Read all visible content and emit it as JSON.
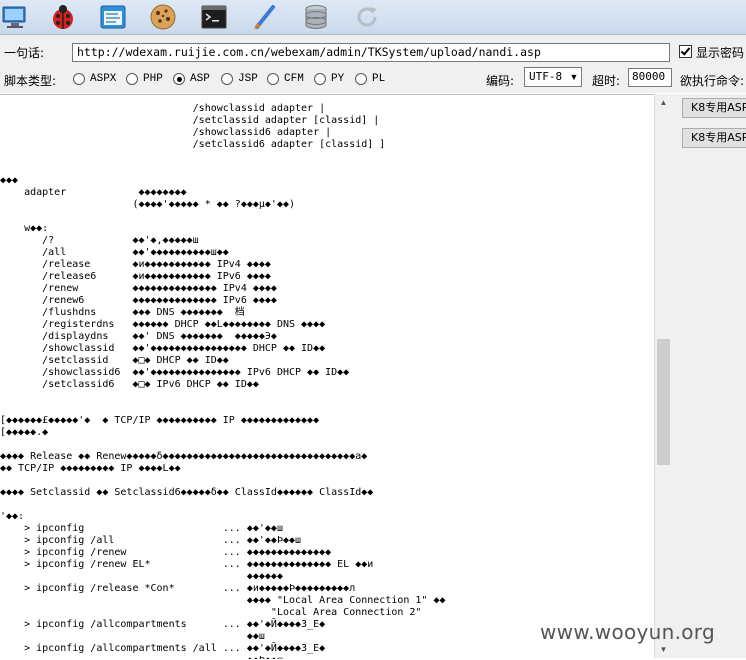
{
  "toolbar": {
    "icons": [
      "monitor-icon",
      "ladybug-icon",
      "window-icon",
      "cookie-icon",
      "terminal-icon",
      "brush-icon",
      "database-icon",
      "refresh-icon"
    ]
  },
  "form": {
    "sentence_label": "一句话:",
    "url_value": "http://wdexam.ruijie.com.cn/webexam/admin/TKSystem/upload/nandi.asp",
    "show_password_label": "显示密码",
    "script_type_label": "脚本类型:",
    "script_types": [
      "ASPX",
      "PHP",
      "ASP",
      "JSP",
      "CFM",
      "PY",
      "PL"
    ],
    "selected_script_type": "ASP",
    "encoding_label": "编码:",
    "encoding_value": "UTF-8",
    "timeout_label": "超时:",
    "timeout_value": "80000",
    "exec_cmd_label": "欲执行命令:"
  },
  "right_panel": {
    "buttons": [
      "K8专用ASP",
      "K8专用ASP"
    ]
  },
  "output": {
    "text": "                                /showclassid adapter |\n                                /setclassid adapter [classid] |\n                                /showclassid6 adapter |\n                                /setclassid6 adapter [classid] ]\n\n\n◆◆◆\n    adapter            ◆◆◆◆◆◆◆◆\n                      (◆◆◆◆'◆◆◆◆◆ * ◆◆ ?◆◆◆µ◆'◆◆)\n\n    w◆◆:\n       /?             ◆◆'◆,◆◆◆◆◆ш\n       /all           ◆◆'◆◆◆◆◆◆◆◆◆◆ш◆◆\n       /release       ◆и◆◆◆◆◆◆◆◆◆◆◆ IPv4 ◆◆◆◆\n       /release6      ◆и◆◆◆◆◆◆◆◆◆◆◆ IPv6 ◆◆◆◆\n       /renew         ◆◆◆◆◆◆◆◆◆◆◆◆◆◆ IPv4 ◆◆◆◆\n       /renew6        ◆◆◆◆◆◆◆◆◆◆◆◆◆◆ IPv6 ◆◆◆◆\n       /flushdns      ◆◆◆ DNS ◆◆◆◆◆◆◆  档\n       /registerdns   ◆◆◆◆◆◆ DHCP ◆◆L◆◆◆◆◆◆◆◆ DNS ◆◆◆◆\n       /displaydns    ◆◆' DNS ◆◆◆◆◆◆◆  ◆◆◆◆◆Э◆\n       /showclassid   ◆◆'◆◆◆◆◆◆◆◆◆◆◆◆◆◆◆◆ DHCP ◆◆ ID◆◆\n       /setclassid    ◆□◆ DHCP ◆◆ ID◆◆\n       /showclassid6  ◆◆'◆◆◆◆◆◆◆◆◆◆◆◆◆◆◆ IPv6 DHCP ◆◆ ID◆◆\n       /setclassid6   ◆□◆ IPv6 DHCP ◆◆ ID◆◆\n\n\n[◆◆◆◆◆◆£◆◆◆◆◆'◆  ◆ TCP/IP ◆◆◆◆◆◆◆◆◆◆ IP ◆◆◆◆◆◆◆◆◆◆◆◆◆\n[◆◆◆◆◆.◆\n\n◆◆◆◆ Release ◆◆ Renew◆◆◆◆◆δ◆◆◆◆◆◆◆◆◆◆◆◆◆◆◆◆◆◆◆◆◆◆◆◆◆◆◆◆◆◆◆◆a◆\n◆◆ TCP/IP ◆◆◆◆◆◆◆◆◆ IP ◆◆◆◆L◆◆\n\n◆◆◆◆ Setclassid ◆◆ Setclassid6◆◆◆◆◆δ◆◆ ClassId◆◆◆◆◆◆ ClassId◆◆\n\n'◆◆:\n    > ipconfig                       ... ◆◆'◆◆ш\n    > ipconfig /all                  ... ◆◆'◆◆Þ◆◆ш\n    > ipconfig /renew                ... ◆◆◆◆◆◆◆◆◆◆◆◆◆◆\n    > ipconfig /renew EL*            ... ◆◆◆◆◆◆◆◆◆◆◆◆◆◆ EL ◆◆и\n                                         ◆◆◆◆◆◆\n    > ipconfig /release *Con*        ... ◆и◆◆◆◆◆Þ◆◆◆◆◆◆◆◆◆л\n                                         ◆◆◆◆ \"Local Area Connection 1\" ◆◆\n                                             \"Local Area Connection 2\"\n    > ipconfig /allcompartments      ... ◆◆'◆Й◆◆◆◆З_Ε◆\n                                         ◆◆ш\n    > ipconfig /allcompartments /all ... ◆◆'◆Й◆◆◆◆З_Ε◆\n                                         ◆◆Þ◆◆ш"
  },
  "watermark": "www.wooyun.org"
}
